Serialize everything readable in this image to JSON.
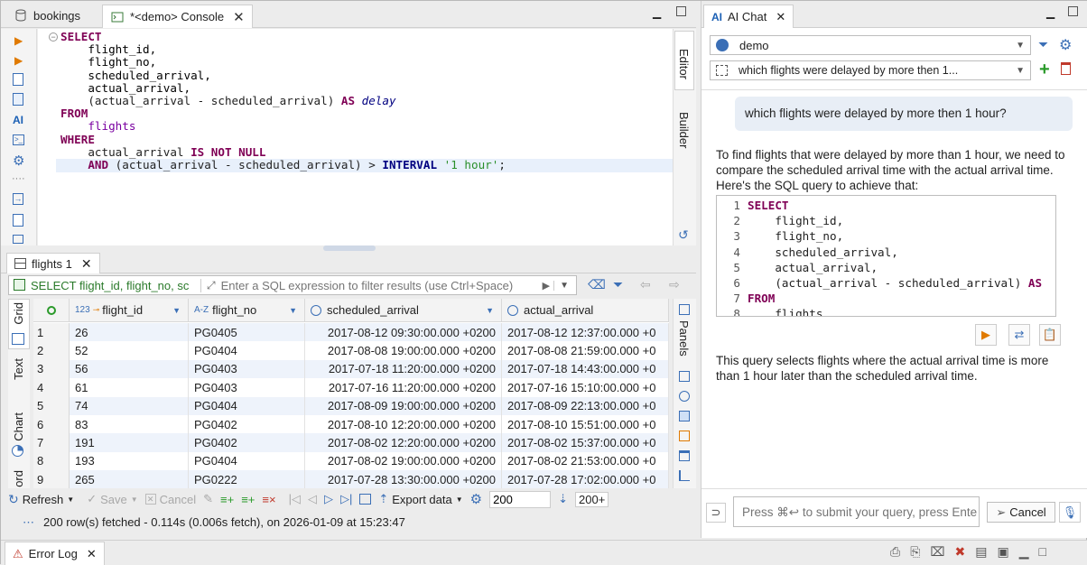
{
  "editor_tabs": [
    {
      "label": "bookings"
    },
    {
      "label": "*<demo> Console"
    }
  ],
  "sql_lines": [
    {
      "html": "<span class='kw'>SELECT</span>"
    },
    {
      "html": "    <span class='id'>flight_id,</span>"
    },
    {
      "html": "    <span class='id'>flight_no,</span>"
    },
    {
      "html": "    <span class='id'>scheduled_arrival,</span>"
    },
    {
      "html": "    <span class='id'>actual_arrival,</span>"
    },
    {
      "html": "    (actual_arrival - scheduled_arrival) <span class='kw'>AS</span> <span class='al'>delay</span>"
    },
    {
      "html": "<span class='kw'>FROM</span>"
    },
    {
      "html": "    <span class='tbl'>flights</span>"
    },
    {
      "html": "<span class='kw'>WHERE</span>"
    },
    {
      "html": "    actual_arrival <span class='kw'>IS NOT NULL</span>"
    },
    {
      "html": "    <span class='kw'>AND</span> (actual_arrival - scheduled_arrival) > <span class='kw2'>INTERVAL</span> <span class='str'>'1 hour'</span>;"
    }
  ],
  "side_tabs": {
    "editor": "Editor",
    "builder": "Builder"
  },
  "results": {
    "tab_label": "flights 1",
    "filter_query": "SELECT flight_id, flight_no, sc",
    "filter_placeholder": "Enter a SQL expression to filter results (use Ctrl+Space)",
    "columns": [
      {
        "type": "123",
        "name": "flight_id"
      },
      {
        "type": "A-Z",
        "name": "flight_no"
      },
      {
        "type": "clock",
        "name": "scheduled_arrival"
      },
      {
        "type": "clock",
        "name": "actual_arrival"
      }
    ],
    "rows": [
      {
        "n": "1",
        "flight_id": "26",
        "flight_no": "PG0405",
        "scheduled": "2017-08-12 09:30:00.000 +0200",
        "actual": "2017-08-12 12:37:00.000 +0"
      },
      {
        "n": "2",
        "flight_id": "52",
        "flight_no": "PG0404",
        "scheduled": "2017-08-08 19:00:00.000 +0200",
        "actual": "2017-08-08 21:59:00.000 +0"
      },
      {
        "n": "3",
        "flight_id": "56",
        "flight_no": "PG0403",
        "scheduled": "2017-07-18 11:20:00.000 +0200",
        "actual": "2017-07-18 14:43:00.000 +0"
      },
      {
        "n": "4",
        "flight_id": "61",
        "flight_no": "PG0403",
        "scheduled": "2017-07-16 11:20:00.000 +0200",
        "actual": "2017-07-16 15:10:00.000 +0"
      },
      {
        "n": "5",
        "flight_id": "74",
        "flight_no": "PG0404",
        "scheduled": "2017-08-09 19:00:00.000 +0200",
        "actual": "2017-08-09 22:13:00.000 +0"
      },
      {
        "n": "6",
        "flight_id": "83",
        "flight_no": "PG0402",
        "scheduled": "2017-08-10 12:20:00.000 +0200",
        "actual": "2017-08-10 15:51:00.000 +0"
      },
      {
        "n": "7",
        "flight_id": "191",
        "flight_no": "PG0402",
        "scheduled": "2017-08-02 12:20:00.000 +0200",
        "actual": "2017-08-02 15:37:00.000 +0"
      },
      {
        "n": "8",
        "flight_id": "193",
        "flight_no": "PG0404",
        "scheduled": "2017-08-02 19:00:00.000 +0200",
        "actual": "2017-08-02 21:53:00.000 +0"
      },
      {
        "n": "9",
        "flight_id": "265",
        "flight_no": "PG0222",
        "scheduled": "2017-07-28 13:30:00.000 +0200",
        "actual": "2017-07-28 17:02:00.000 +0"
      }
    ],
    "left_tabs": {
      "grid": "Grid",
      "text": "Text",
      "chart": "Chart",
      "record": "ord"
    },
    "panels_label": "Panels",
    "toolbar": {
      "refresh": "Refresh",
      "save": "Save",
      "cancel": "Cancel",
      "export": "Export data",
      "fetch_size": "200",
      "fetch_all": "200+"
    },
    "status": "200 row(s) fetched - 0.114s (0.006s fetch), on 2026-01-09 at 15:23:47"
  },
  "bottom": {
    "error_log": "Error Log"
  },
  "ai_chat": {
    "tab_label": "AI Chat",
    "connection": "demo",
    "conversation": "which flights were delayed by more then 1...",
    "user_message": "which flights were delayed by more then 1 hour?",
    "answer_intro": "To find flights that were delayed by more than 1 hour, we need to compare the scheduled arrival time with the actual arrival time. Here's the SQL query to achieve that:",
    "code_lines": [
      {
        "n": "1",
        "html": "<span class='kw'>SELECT</span>"
      },
      {
        "n": "2",
        "html": "    flight_id,"
      },
      {
        "n": "3",
        "html": "    flight_no,"
      },
      {
        "n": "4",
        "html": "    scheduled_arrival,"
      },
      {
        "n": "5",
        "html": "    actual_arrival,"
      },
      {
        "n": "6",
        "html": "    (actual_arrival - scheduled_arrival) <span class='kw'>AS</span>"
      },
      {
        "n": "7",
        "html": "<span class='kw'>FROM</span>"
      },
      {
        "n": "8",
        "html": "    flights"
      }
    ],
    "answer_outro": "This query selects flights where the actual arrival time is more than 1 hour later than the scheduled arrival time.",
    "input_placeholder": "Press ⌘↩ to submit your query, press Ente",
    "cancel_label": "Cancel"
  }
}
